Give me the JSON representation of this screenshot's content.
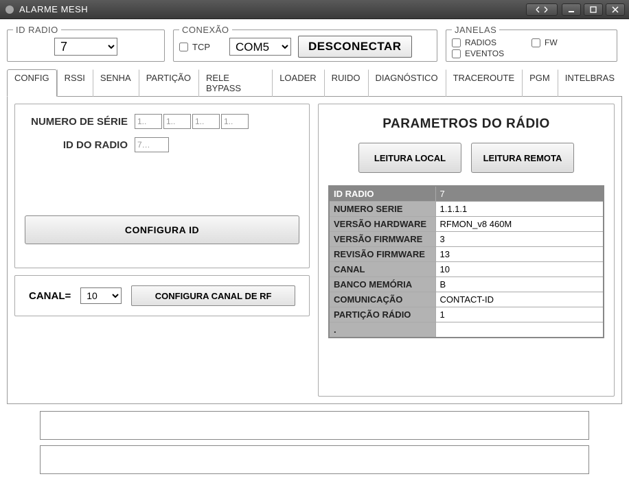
{
  "window": {
    "title": "ALARME MESH"
  },
  "groups": {
    "id_radio": {
      "legend": "ID RADIO",
      "value": "7"
    },
    "conexao": {
      "legend": "CONEXÃO",
      "tcp_label": "TCP",
      "tcp_checked": false,
      "com_value": "COM5",
      "disconnect_label": "DESCONECTAR"
    },
    "janelas": {
      "legend": "JANELAS",
      "radios_label": "RADIOS",
      "radios_checked": false,
      "fw_label": "FW",
      "fw_checked": false,
      "eventos_label": "EVENTOS",
      "eventos_checked": false
    }
  },
  "tabs": [
    "CONFIG",
    "RSSI",
    "SENHA",
    "PARTIÇÃO",
    "RELE BYPASS",
    "LOADER",
    "RUIDO",
    "DIAGNÓSTICO",
    "TRACEROUTE",
    "PGM",
    "INTELBRAS"
  ],
  "active_tab": 0,
  "config_panel": {
    "serial_label": "NUMERO DE SÉRIE",
    "serial_values": [
      "1..",
      "1..",
      "1..",
      "1.."
    ],
    "radio_id_label": "ID DO RADIO",
    "radio_id_value": "7…",
    "configure_id_label": "CONFIGURA ID",
    "canal_label": "CANAL=",
    "canal_value": "10",
    "configure_rf_label": "CONFIGURA CANAL DE RF"
  },
  "params_panel": {
    "title": "PARAMETROS DO RÁDIO",
    "read_local_label": "LEITURA LOCAL",
    "read_remote_label": "LEITURA REMOTA",
    "rows": [
      {
        "k": "ID RADIO",
        "v": "7",
        "hi": true
      },
      {
        "k": "NUMERO SERIE",
        "v": "1.1.1.1"
      },
      {
        "k": "VERSÃO HARDWARE",
        "v": "RFMON_v8 460M"
      },
      {
        "k": "VERSÃO FIRMWARE",
        "v": "3"
      },
      {
        "k": "REVISÃO FIRMWARE",
        "v": "13"
      },
      {
        "k": "CANAL",
        "v": "10"
      },
      {
        "k": "BANCO MEMÓRIA",
        "v": "B"
      },
      {
        "k": "COMUNICAÇÃO",
        "v": "CONTACT-ID"
      },
      {
        "k": "PARTIÇÃO RÁDIO",
        "v": "1"
      },
      {
        "k": ".",
        "v": ""
      }
    ]
  }
}
